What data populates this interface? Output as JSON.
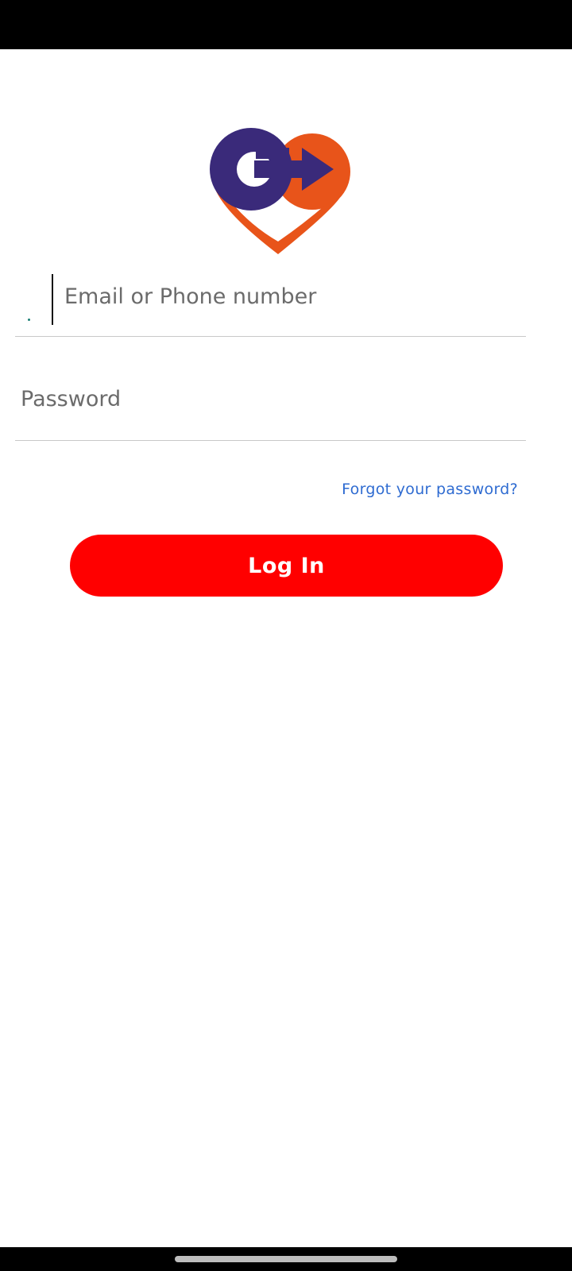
{
  "login": {
    "email_placeholder": "Email or Phone number",
    "password_placeholder": "Password",
    "forgot_password_label": "Forgot your password?",
    "login_button_label": "Log In"
  },
  "icons": {
    "logo": "go-heart-arrow-logo",
    "country": "country-code-dot"
  },
  "colors": {
    "login_button": "#ff0000",
    "link": "#2e6bd1",
    "logo_purple": "#3a2a7a",
    "logo_orange": "#e8541a"
  }
}
